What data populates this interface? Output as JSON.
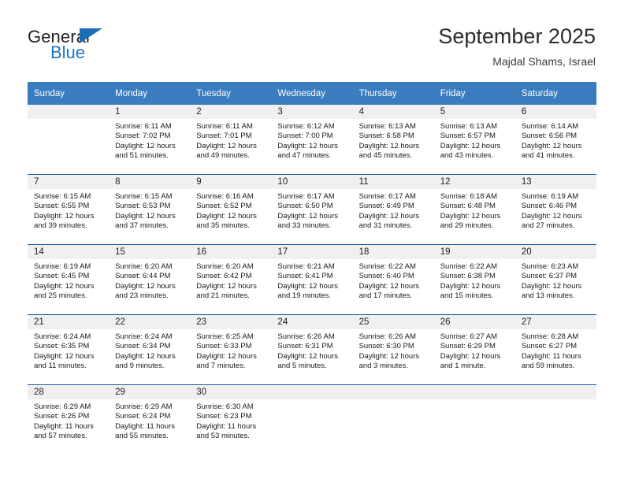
{
  "brand": {
    "name_part1": "General",
    "name_part2": "Blue",
    "logo_icon": "blue-triangle-icon",
    "accent_color": "#1c76c4"
  },
  "header": {
    "title": "September 2025",
    "subtitle": "Majdal Shams, Israel"
  },
  "theme": {
    "header_bg": "#3a7cbe",
    "row_divider": "#1d5fa0",
    "daynum_band_bg": "#f0f0f0"
  },
  "weekday_headers": [
    "Sunday",
    "Monday",
    "Tuesday",
    "Wednesday",
    "Thursday",
    "Friday",
    "Saturday"
  ],
  "weeks": [
    [
      {
        "day": "",
        "sunrise": "",
        "sunset": "",
        "daylight_line1": "",
        "daylight_line2": "",
        "empty": true
      },
      {
        "day": "1",
        "sunrise": "Sunrise: 6:11 AM",
        "sunset": "Sunset: 7:02 PM",
        "daylight_line1": "Daylight: 12 hours",
        "daylight_line2": "and 51 minutes."
      },
      {
        "day": "2",
        "sunrise": "Sunrise: 6:11 AM",
        "sunset": "Sunset: 7:01 PM",
        "daylight_line1": "Daylight: 12 hours",
        "daylight_line2": "and 49 minutes."
      },
      {
        "day": "3",
        "sunrise": "Sunrise: 6:12 AM",
        "sunset": "Sunset: 7:00 PM",
        "daylight_line1": "Daylight: 12 hours",
        "daylight_line2": "and 47 minutes."
      },
      {
        "day": "4",
        "sunrise": "Sunrise: 6:13 AM",
        "sunset": "Sunset: 6:58 PM",
        "daylight_line1": "Daylight: 12 hours",
        "daylight_line2": "and 45 minutes."
      },
      {
        "day": "5",
        "sunrise": "Sunrise: 6:13 AM",
        "sunset": "Sunset: 6:57 PM",
        "daylight_line1": "Daylight: 12 hours",
        "daylight_line2": "and 43 minutes."
      },
      {
        "day": "6",
        "sunrise": "Sunrise: 6:14 AM",
        "sunset": "Sunset: 6:56 PM",
        "daylight_line1": "Daylight: 12 hours",
        "daylight_line2": "and 41 minutes."
      }
    ],
    [
      {
        "day": "7",
        "sunrise": "Sunrise: 6:15 AM",
        "sunset": "Sunset: 6:55 PM",
        "daylight_line1": "Daylight: 12 hours",
        "daylight_line2": "and 39 minutes."
      },
      {
        "day": "8",
        "sunrise": "Sunrise: 6:15 AM",
        "sunset": "Sunset: 6:53 PM",
        "daylight_line1": "Daylight: 12 hours",
        "daylight_line2": "and 37 minutes."
      },
      {
        "day": "9",
        "sunrise": "Sunrise: 6:16 AM",
        "sunset": "Sunset: 6:52 PM",
        "daylight_line1": "Daylight: 12 hours",
        "daylight_line2": "and 35 minutes."
      },
      {
        "day": "10",
        "sunrise": "Sunrise: 6:17 AM",
        "sunset": "Sunset: 6:50 PM",
        "daylight_line1": "Daylight: 12 hours",
        "daylight_line2": "and 33 minutes."
      },
      {
        "day": "11",
        "sunrise": "Sunrise: 6:17 AM",
        "sunset": "Sunset: 6:49 PM",
        "daylight_line1": "Daylight: 12 hours",
        "daylight_line2": "and 31 minutes."
      },
      {
        "day": "12",
        "sunrise": "Sunrise: 6:18 AM",
        "sunset": "Sunset: 6:48 PM",
        "daylight_line1": "Daylight: 12 hours",
        "daylight_line2": "and 29 minutes."
      },
      {
        "day": "13",
        "sunrise": "Sunrise: 6:19 AM",
        "sunset": "Sunset: 6:46 PM",
        "daylight_line1": "Daylight: 12 hours",
        "daylight_line2": "and 27 minutes."
      }
    ],
    [
      {
        "day": "14",
        "sunrise": "Sunrise: 6:19 AM",
        "sunset": "Sunset: 6:45 PM",
        "daylight_line1": "Daylight: 12 hours",
        "daylight_line2": "and 25 minutes."
      },
      {
        "day": "15",
        "sunrise": "Sunrise: 6:20 AM",
        "sunset": "Sunset: 6:44 PM",
        "daylight_line1": "Daylight: 12 hours",
        "daylight_line2": "and 23 minutes."
      },
      {
        "day": "16",
        "sunrise": "Sunrise: 6:20 AM",
        "sunset": "Sunset: 6:42 PM",
        "daylight_line1": "Daylight: 12 hours",
        "daylight_line2": "and 21 minutes."
      },
      {
        "day": "17",
        "sunrise": "Sunrise: 6:21 AM",
        "sunset": "Sunset: 6:41 PM",
        "daylight_line1": "Daylight: 12 hours",
        "daylight_line2": "and 19 minutes."
      },
      {
        "day": "18",
        "sunrise": "Sunrise: 6:22 AM",
        "sunset": "Sunset: 6:40 PM",
        "daylight_line1": "Daylight: 12 hours",
        "daylight_line2": "and 17 minutes."
      },
      {
        "day": "19",
        "sunrise": "Sunrise: 6:22 AM",
        "sunset": "Sunset: 6:38 PM",
        "daylight_line1": "Daylight: 12 hours",
        "daylight_line2": "and 15 minutes."
      },
      {
        "day": "20",
        "sunrise": "Sunrise: 6:23 AM",
        "sunset": "Sunset: 6:37 PM",
        "daylight_line1": "Daylight: 12 hours",
        "daylight_line2": "and 13 minutes."
      }
    ],
    [
      {
        "day": "21",
        "sunrise": "Sunrise: 6:24 AM",
        "sunset": "Sunset: 6:35 PM",
        "daylight_line1": "Daylight: 12 hours",
        "daylight_line2": "and 11 minutes."
      },
      {
        "day": "22",
        "sunrise": "Sunrise: 6:24 AM",
        "sunset": "Sunset: 6:34 PM",
        "daylight_line1": "Daylight: 12 hours",
        "daylight_line2": "and 9 minutes."
      },
      {
        "day": "23",
        "sunrise": "Sunrise: 6:25 AM",
        "sunset": "Sunset: 6:33 PM",
        "daylight_line1": "Daylight: 12 hours",
        "daylight_line2": "and 7 minutes."
      },
      {
        "day": "24",
        "sunrise": "Sunrise: 6:26 AM",
        "sunset": "Sunset: 6:31 PM",
        "daylight_line1": "Daylight: 12 hours",
        "daylight_line2": "and 5 minutes."
      },
      {
        "day": "25",
        "sunrise": "Sunrise: 6:26 AM",
        "sunset": "Sunset: 6:30 PM",
        "daylight_line1": "Daylight: 12 hours",
        "daylight_line2": "and 3 minutes."
      },
      {
        "day": "26",
        "sunrise": "Sunrise: 6:27 AM",
        "sunset": "Sunset: 6:29 PM",
        "daylight_line1": "Daylight: 12 hours",
        "daylight_line2": "and 1 minute."
      },
      {
        "day": "27",
        "sunrise": "Sunrise: 6:28 AM",
        "sunset": "Sunset: 6:27 PM",
        "daylight_line1": "Daylight: 11 hours",
        "daylight_line2": "and 59 minutes."
      }
    ],
    [
      {
        "day": "28",
        "sunrise": "Sunrise: 6:29 AM",
        "sunset": "Sunset: 6:26 PM",
        "daylight_line1": "Daylight: 11 hours",
        "daylight_line2": "and 57 minutes."
      },
      {
        "day": "29",
        "sunrise": "Sunrise: 6:29 AM",
        "sunset": "Sunset: 6:24 PM",
        "daylight_line1": "Daylight: 11 hours",
        "daylight_line2": "and 55 minutes."
      },
      {
        "day": "30",
        "sunrise": "Sunrise: 6:30 AM",
        "sunset": "Sunset: 6:23 PM",
        "daylight_line1": "Daylight: 11 hours",
        "daylight_line2": "and 53 minutes."
      },
      {
        "day": "",
        "sunrise": "",
        "sunset": "",
        "daylight_line1": "",
        "daylight_line2": "",
        "empty": true
      },
      {
        "day": "",
        "sunrise": "",
        "sunset": "",
        "daylight_line1": "",
        "daylight_line2": "",
        "empty": true
      },
      {
        "day": "",
        "sunrise": "",
        "sunset": "",
        "daylight_line1": "",
        "daylight_line2": "",
        "empty": true
      },
      {
        "day": "",
        "sunrise": "",
        "sunset": "",
        "daylight_line1": "",
        "daylight_line2": "",
        "empty": true
      }
    ]
  ]
}
